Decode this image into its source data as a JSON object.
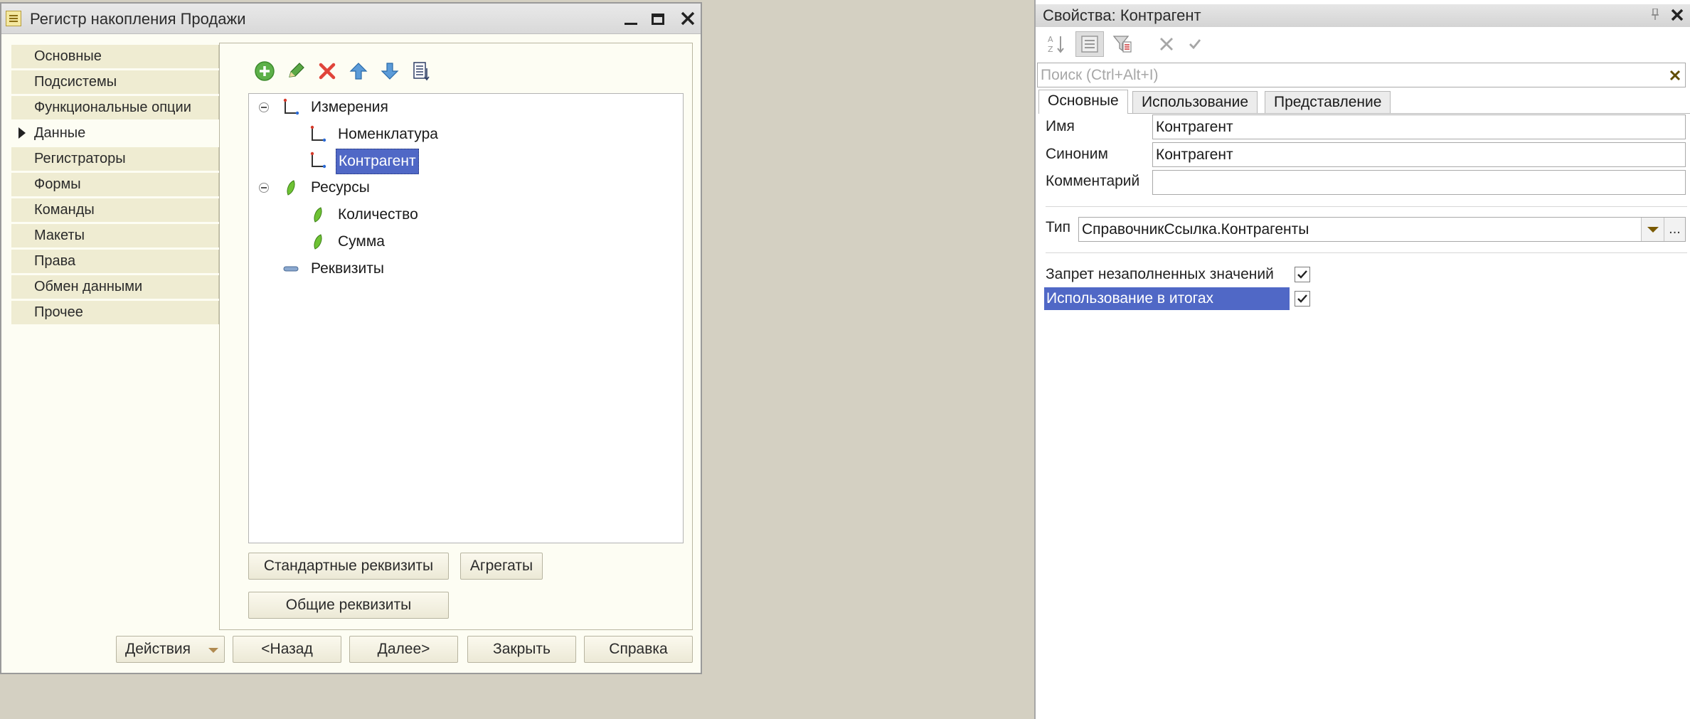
{
  "window": {
    "title": "Регистр накопления Продажи",
    "nav_items": [
      {
        "label": "Основные"
      },
      {
        "label": "Подсистемы"
      },
      {
        "label": "Функциональные опции"
      },
      {
        "label": "Данные",
        "active": true
      },
      {
        "label": "Регистраторы"
      },
      {
        "label": "Формы"
      },
      {
        "label": "Команды"
      },
      {
        "label": "Макеты"
      },
      {
        "label": "Права"
      },
      {
        "label": "Обмен данными"
      },
      {
        "label": "Прочее"
      }
    ],
    "toolbar_icons": [
      "add-icon",
      "edit-icon",
      "delete-icon",
      "move-up-icon",
      "move-down-icon",
      "sort-list-icon"
    ],
    "tree": {
      "dimensions": {
        "label": "Измерения",
        "children": [
          "Номенклатура",
          "Контрагент"
        ],
        "selected": "Контрагент"
      },
      "resources": {
        "label": "Ресурсы",
        "children": [
          "Количество",
          "Сумма"
        ]
      },
      "attributes": {
        "label": "Реквизиты"
      }
    },
    "buttons": {
      "standard_attributes": "Стандартные реквизиты",
      "aggregates": "Агрегаты",
      "common_attributes": "Общие реквизиты",
      "actions": "Действия",
      "back": "<Назад",
      "next": "Далее>",
      "close": "Закрыть",
      "help": "Справка"
    }
  },
  "properties": {
    "title": "Свойства: Контрагент",
    "search_placeholder": "Поиск (Ctrl+Alt+I)",
    "tabs": [
      "Основные",
      "Использование",
      "Представление"
    ],
    "fields": {
      "name_label": "Имя",
      "name_value": "Контрагент",
      "synonym_label": "Синоним",
      "synonym_value": "Контрагент",
      "comment_label": "Комментарий",
      "comment_value": "",
      "type_label": "Тип",
      "type_value": "СправочникСсылка.Контрагенты",
      "dots": "..."
    },
    "checkboxes": [
      {
        "label": "Запрет незаполненных значений",
        "checked": true
      },
      {
        "label": "Использование в итогах",
        "checked": true,
        "highlighted": true
      }
    ]
  },
  "colors": {
    "selection": "#5068c6",
    "nav_bg": "#efecd2",
    "panel_bg": "#fdfdf3",
    "desktop_bg": "#d4d0c2"
  }
}
